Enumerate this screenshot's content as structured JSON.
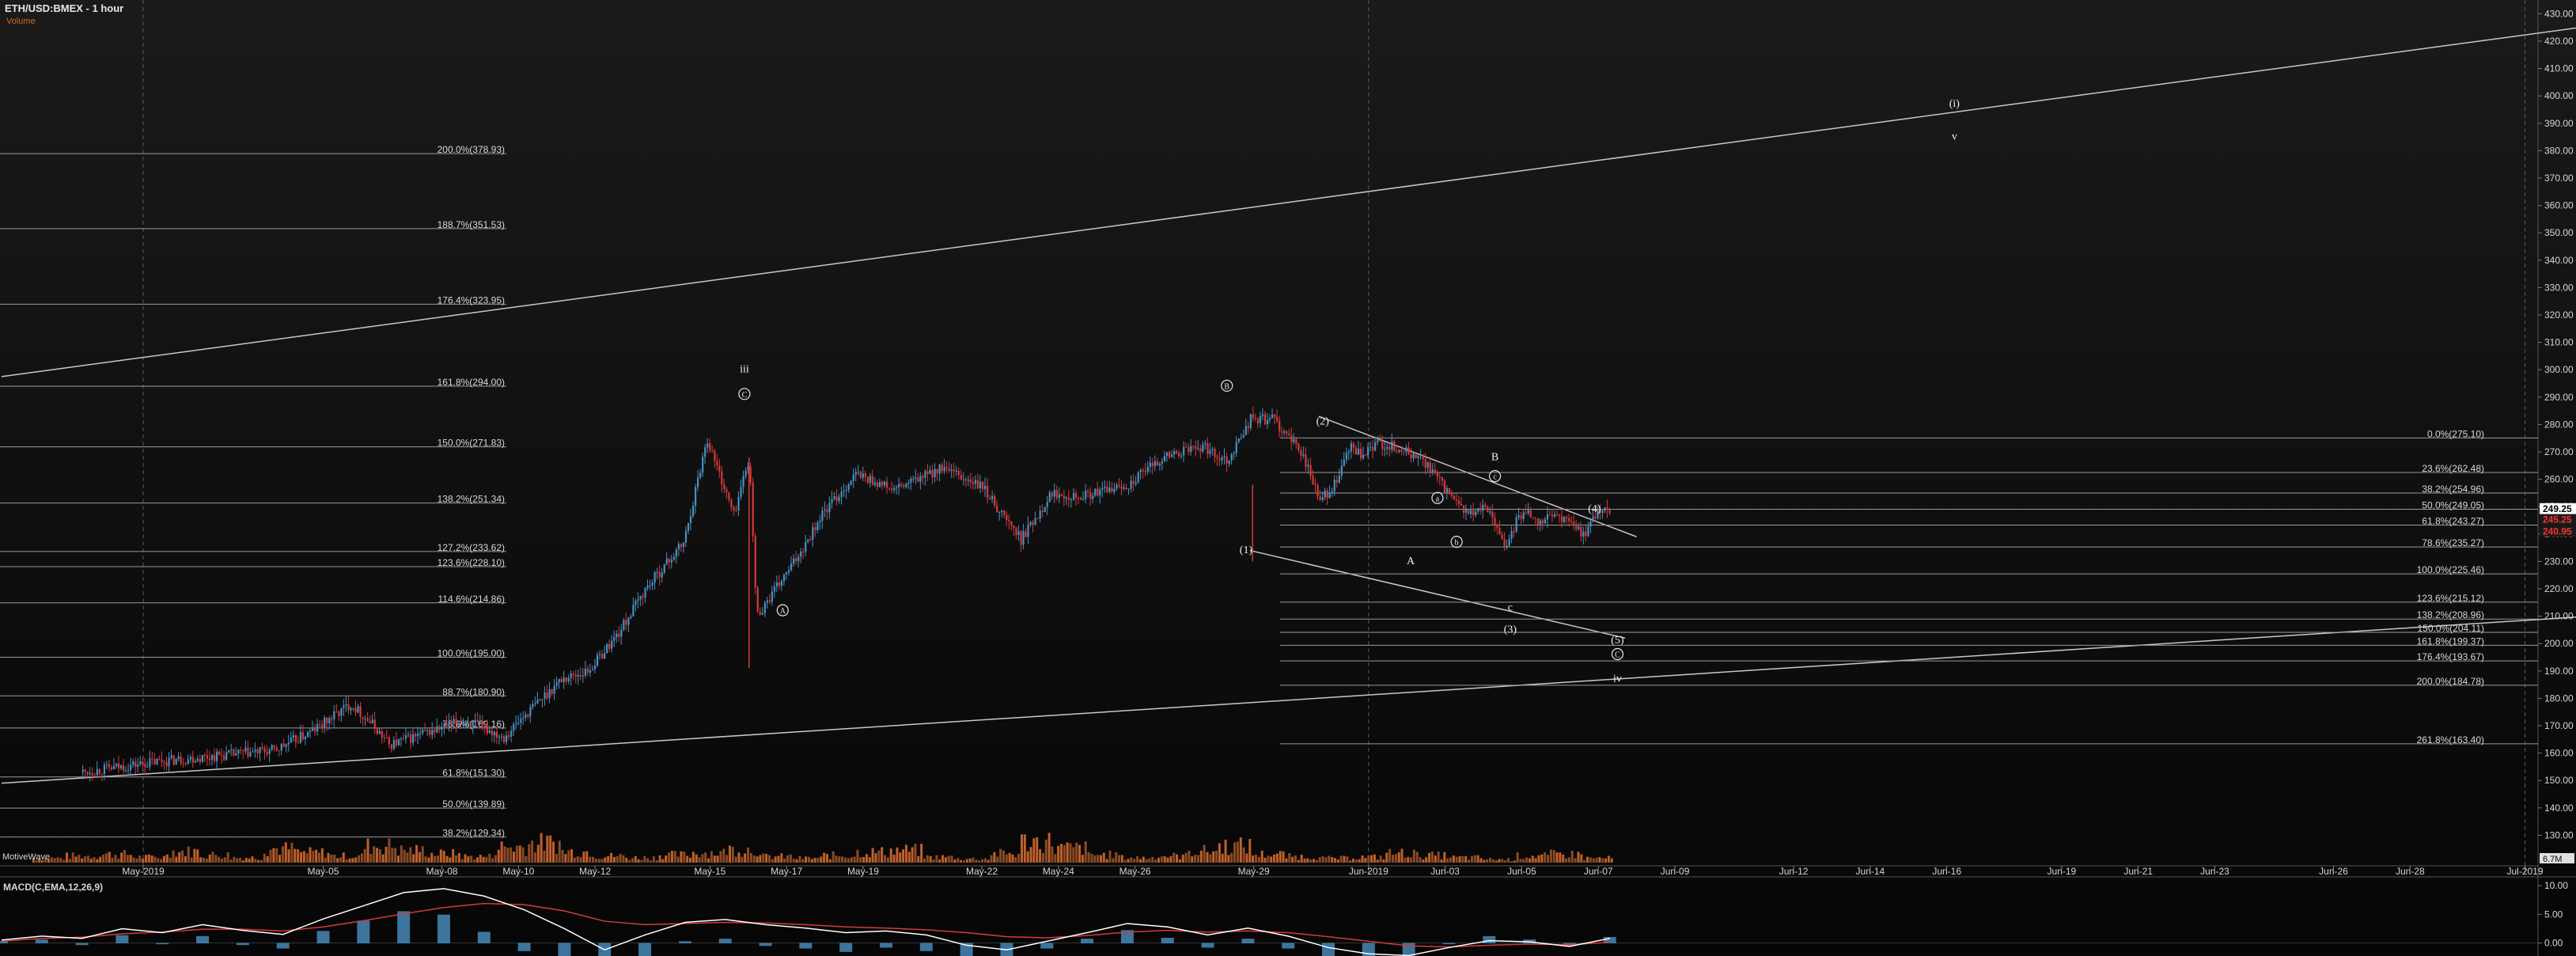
{
  "header": {
    "symbol": "ETH/USD:BMEX - 1 hour",
    "volume_label": "Volume"
  },
  "colors": {
    "background": "#0a0a0a",
    "up": "#4a90c2",
    "down": "#d43a3a",
    "line": "#c8c8c8",
    "text": "#d8d8d8",
    "volume": "#c0602a",
    "macd": "#ffffff",
    "signal": "#d43a3a",
    "histogram": "#4a90c2"
  },
  "chart_data": {
    "type": "candlestick",
    "title": "ETH/USD:BMEX - 1 hour",
    "ylim": [
      120,
      435
    ],
    "price_ticks": [
      130,
      140,
      150,
      160,
      170,
      180,
      190,
      200,
      210,
      220,
      230,
      240,
      250,
      260,
      270,
      280,
      290,
      300,
      310,
      320,
      330,
      340,
      350,
      360,
      370,
      380,
      390,
      400,
      410,
      420,
      430
    ],
    "price_tick_labels": [
      "130.00",
      "140.00",
      "150.00",
      "160.00",
      "170.00",
      "180.00",
      "190.00",
      "200.00",
      "210.00",
      "220.00",
      "230.00",
      "240.00",
      "250.00",
      "260.00",
      "270.00",
      "280.00",
      "290.00",
      "300.00",
      "310.00",
      "320.00",
      "330.00",
      "340.00",
      "350.00",
      "360.00",
      "370.00",
      "380.00",
      "390.00",
      "400.00",
      "410.00",
      "420.00",
      "430.00"
    ],
    "x_ticks": [
      {
        "label": "May-2019",
        "day": 0.6
      },
      {
        "label": "May-05",
        "day": 5.3
      },
      {
        "label": "May-08",
        "day": 8.4
      },
      {
        "label": "May-10",
        "day": 10.4
      },
      {
        "label": "May-12",
        "day": 12.4
      },
      {
        "label": "May-15",
        "day": 15.4
      },
      {
        "label": "May-17",
        "day": 17.4
      },
      {
        "label": "May-19",
        "day": 19.4
      },
      {
        "label": "May-22",
        "day": 22.5
      },
      {
        "label": "May-24",
        "day": 24.5
      },
      {
        "label": "May-26",
        "day": 26.5
      },
      {
        "label": "May-29",
        "day": 29.6
      },
      {
        "label": "Jun-2019",
        "day": 32.6
      },
      {
        "label": "Jun-03",
        "day": 34.6
      },
      {
        "label": "Jun-05",
        "day": 36.6
      },
      {
        "label": "Jun-07",
        "day": 38.6
      },
      {
        "label": "Jun-09",
        "day": 40.6
      },
      {
        "label": "Jun-12",
        "day": 43.7
      },
      {
        "label": "Jun-14",
        "day": 45.7
      },
      {
        "label": "Jun-16",
        "day": 47.7
      },
      {
        "label": "Jun-19",
        "day": 50.7
      },
      {
        "label": "Jun-21",
        "day": 52.7
      },
      {
        "label": "Jun-23",
        "day": 54.7
      },
      {
        "label": "Jun-26",
        "day": 57.8
      },
      {
        "label": "Jun-28",
        "day": 59.8
      },
      {
        "label": "Jul-2019",
        "day": 62.8
      }
    ],
    "path_days": [
      -1,
      1,
      4,
      5,
      6,
      6.6,
      7,
      9,
      10,
      10.7,
      11.5,
      12.2,
      13,
      13.7,
      14.7,
      15.3,
      16,
      16.4,
      16.6,
      17.5,
      18.3,
      19.2,
      20.2,
      21.4,
      22.5,
      23.5,
      24.3,
      25.2,
      26.3,
      27.2,
      28.2,
      28.9,
      29.5,
      30.1,
      30.9,
      31.3,
      31.7,
      31.9,
      32.1,
      32.4,
      32.8,
      33.2,
      34.0,
      34.6,
      34.9,
      35.3,
      35.7,
      36.2,
      36.4,
      36.7,
      37.0,
      37.5,
      38.2,
      38.6,
      38.9
    ],
    "path_prices": [
      153,
      157,
      161,
      168,
      178,
      170,
      163,
      172,
      166,
      176,
      187,
      190,
      204,
      220,
      237,
      275,
      247,
      268,
      210,
      228,
      247,
      262,
      256,
      264,
      257,
      238,
      255,
      254,
      258,
      268,
      272,
      267,
      282,
      282,
      268,
      252,
      258,
      265,
      272,
      268,
      273,
      272,
      267,
      256,
      250,
      247,
      250,
      234,
      244,
      249,
      245,
      247,
      240,
      249,
      248
    ],
    "volume_bars": [
      8,
      12,
      15,
      10,
      20,
      14,
      9,
      25,
      18,
      12,
      30,
      22,
      16,
      11,
      28,
      35,
      20,
      12,
      9,
      14,
      18,
      24,
      11,
      8,
      13,
      19,
      22,
      10,
      7,
      16,
      38,
      26,
      14,
      9,
      12,
      21,
      30,
      15,
      11,
      8,
      10,
      17,
      13,
      9,
      6,
      12,
      15,
      8
    ],
    "volume_label": "6.7M",
    "indicator_label": "MotiveWave",
    "fib_levels_left": [
      {
        "label": "200.0%(378.93)",
        "price": 378.93
      },
      {
        "label": "188.7%(351.53)",
        "price": 351.53
      },
      {
        "label": "176.4%(323.95)",
        "price": 323.95
      },
      {
        "label": "161.8%(294.00)",
        "price": 294.0
      },
      {
        "label": "150.0%(271.83)",
        "price": 271.83
      },
      {
        "label": "138.2%(251.34)",
        "price": 251.34
      },
      {
        "label": "127.2%(233.62)",
        "price": 233.62
      },
      {
        "label": "123.6%(228.10)",
        "price": 228.1
      },
      {
        "label": "114.6%(214.86)",
        "price": 214.86
      },
      {
        "label": "100.0%(195.00)",
        "price": 195.0
      },
      {
        "label": "88.7%(180.90)",
        "price": 180.9
      },
      {
        "label": "78.6%(169.16)",
        "price": 169.16
      },
      {
        "label": "61.8%(151.30)",
        "price": 151.3
      },
      {
        "label": "50.0%(139.89)",
        "price": 139.89
      },
      {
        "label": "38.2%(129.34)",
        "price": 129.34
      }
    ],
    "fib_levels_right": [
      {
        "label": "0.0%(275.10)",
        "price": 275.1
      },
      {
        "label": "23.6%(262.48)",
        "price": 262.48
      },
      {
        "label": "38.2%(254.96)",
        "price": 254.96
      },
      {
        "label": "50.0%(249.05)",
        "price": 249.05
      },
      {
        "label": "61.8%(243.27)",
        "price": 243.27
      },
      {
        "label": "78.6%(235.27)",
        "price": 235.27
      },
      {
        "label": "100.0%(225.46)",
        "price": 225.46
      },
      {
        "label": "123.6%(215.12)",
        "price": 215.12
      },
      {
        "label": "138.2%(208.96)",
        "price": 208.96
      },
      {
        "label": "150.0%(204.11)",
        "price": 204.11
      },
      {
        "label": "161.8%(199.37)",
        "price": 199.37
      },
      {
        "label": "176.4%(193.67)",
        "price": 193.67
      },
      {
        "label": "200.0%(184.78)",
        "price": 184.78
      },
      {
        "label": "261.8%(163.40)",
        "price": 163.4
      }
    ],
    "price_tags": [
      {
        "label": "249.25",
        "price": 249.25,
        "color": "#ffffff"
      },
      {
        "label": "245.25",
        "price": 245.25,
        "color": "#ff3030"
      },
      {
        "label": "240.95",
        "price": 240.95,
        "color": "#ff3030"
      }
    ],
    "wave_labels": [
      {
        "text": "iii",
        "day": 16.3,
        "price": 299,
        "circled": false
      },
      {
        "text": "C",
        "day": 16.3,
        "price": 290,
        "circled": true
      },
      {
        "text": "A",
        "day": 17.3,
        "price": 211,
        "circled": true
      },
      {
        "text": "B",
        "day": 28.9,
        "price": 293,
        "circled": true
      },
      {
        "text": "(2)",
        "day": 31.4,
        "price": 280,
        "circled": false
      },
      {
        "text": "(1)",
        "day": 29.4,
        "price": 233,
        "circled": false
      },
      {
        "text": "a",
        "day": 34.4,
        "price": 252,
        "circled": true
      },
      {
        "text": "b",
        "day": 34.9,
        "price": 236,
        "circled": true
      },
      {
        "text": "A",
        "day": 33.7,
        "price": 229,
        "circled": false
      },
      {
        "text": "B",
        "day": 35.9,
        "price": 267,
        "circled": false
      },
      {
        "text": "c",
        "day": 35.9,
        "price": 260,
        "circled": true
      },
      {
        "text": "(4)",
        "day": 38.5,
        "price": 248,
        "circled": false
      },
      {
        "text": "c",
        "day": 36.3,
        "price": 212,
        "circled": false
      },
      {
        "text": "(3)",
        "day": 36.3,
        "price": 204,
        "circled": false
      },
      {
        "text": "(5)",
        "day": 39.1,
        "price": 200,
        "circled": false
      },
      {
        "text": "C",
        "day": 39.1,
        "price": 195,
        "circled": true
      },
      {
        "text": "iv",
        "day": 39.1,
        "price": 186,
        "circled": false
      },
      {
        "text": "(i)",
        "day": 47.9,
        "price": 396,
        "circled": false
      },
      {
        "text": "v",
        "day": 47.9,
        "price": 384,
        "circled": false
      }
    ],
    "macd_label": "MACD(C,EMA,12,26,9)",
    "macd_ylim": [
      -2,
      11
    ],
    "macd_ticks": [
      {
        "label": "10.00",
        "value": 10
      },
      {
        "label": "5.00",
        "value": 5
      },
      {
        "label": "0.00",
        "value": 0
      }
    ],
    "macd_values": [
      0.5,
      1.2,
      0.8,
      2.5,
      1.8,
      3.2,
      2.2,
      1.5,
      4.2,
      6.5,
      8.8,
      9.5,
      8.2,
      5.8,
      2.5,
      -1.2,
      1.4,
      3.6,
      4.1,
      3.2,
      2.6,
      1.8,
      2.1,
      1.4,
      -0.4,
      -1.2,
      0.3,
      1.8,
      3.4,
      2.8,
      1.4,
      2.6,
      1.2,
      -0.8,
      -1.9,
      -2.2,
      -0.8,
      0.4,
      0.2,
      -0.6,
      0.8
    ],
    "signal_values": [
      0.3,
      0.8,
      1.0,
      1.6,
      1.9,
      2.4,
      2.4,
      2.1,
      2.8,
      3.9,
      5.1,
      6.2,
      6.9,
      6.7,
      5.6,
      3.8,
      3.2,
      3.4,
      3.6,
      3.5,
      3.2,
      2.8,
      2.6,
      2.3,
      1.8,
      1.1,
      0.9,
      1.3,
      1.9,
      2.2,
      1.9,
      2.1,
      1.8,
      1.1,
      0.3,
      -0.5,
      -0.7,
      -0.4,
      -0.2,
      -0.3,
      0.1
    ]
  }
}
